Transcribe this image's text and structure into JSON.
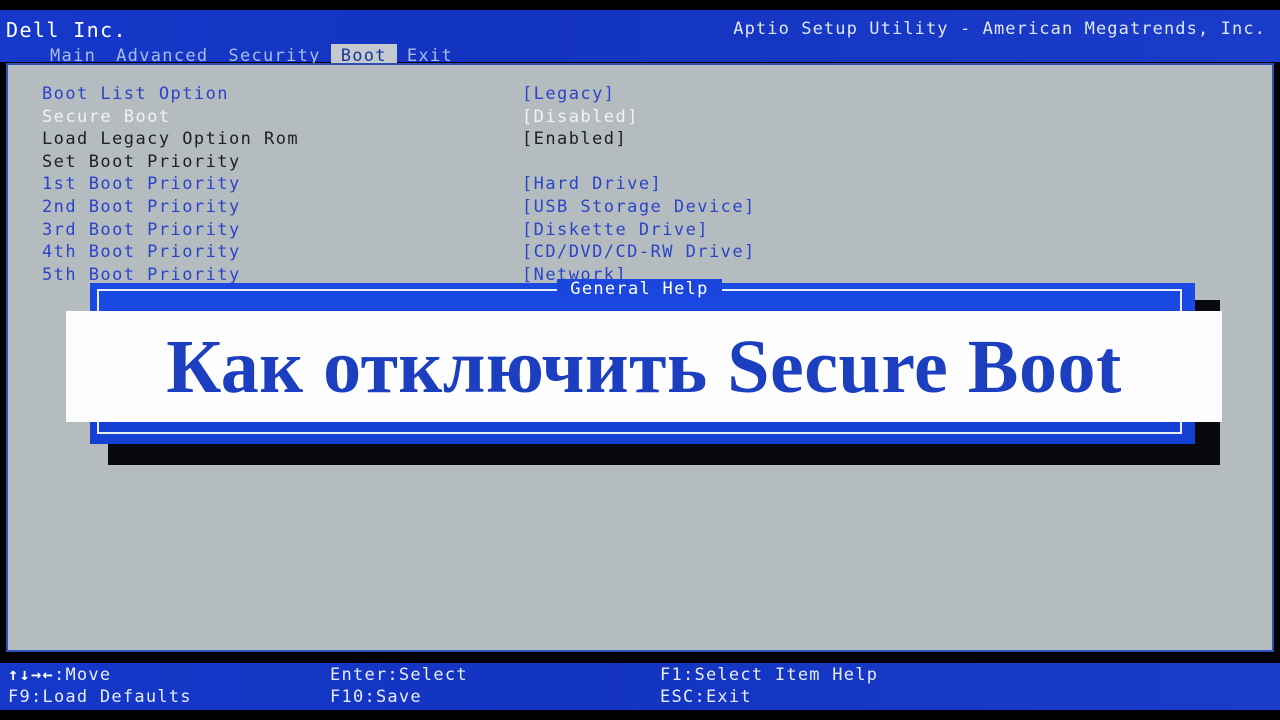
{
  "header": {
    "vendor": "Dell Inc.",
    "utility_title": "Aptio Setup Utility - American Megatrends, Inc.",
    "tabs": [
      {
        "label": "Main",
        "active": false
      },
      {
        "label": "Advanced",
        "active": false
      },
      {
        "label": "Security",
        "active": false
      },
      {
        "label": "Boot",
        "active": true
      },
      {
        "label": "Exit",
        "active": false
      }
    ]
  },
  "settings": [
    {
      "label": "Boot List Option",
      "value": "[Legacy]",
      "label_color": "blue",
      "value_color": "blue"
    },
    {
      "label": "Secure Boot",
      "value": "[Disabled]",
      "label_color": "white",
      "value_color": "white"
    },
    {
      "label": "Load Legacy Option Rom",
      "value": "[Enabled]",
      "label_color": "dark",
      "value_color": "dark"
    },
    {
      "label": "Set Boot Priority",
      "value": "",
      "label_color": "dark",
      "value_color": "dark"
    },
    {
      "label": "1st Boot Priority",
      "value": "[Hard Drive]",
      "label_color": "blue",
      "value_color": "blue"
    },
    {
      "label": "2nd Boot Priority",
      "value": "[USB Storage Device]",
      "label_color": "blue",
      "value_color": "blue"
    },
    {
      "label": "3rd Boot Priority",
      "value": "[Diskette Drive]",
      "label_color": "blue",
      "value_color": "blue"
    },
    {
      "label": "4th Boot Priority",
      "value": "[CD/DVD/CD-RW Drive]",
      "label_color": "blue",
      "value_color": "blue"
    },
    {
      "label": "5th Boot Priority",
      "value": "[Network]",
      "label_color": "blue",
      "value_color": "blue"
    }
  ],
  "dialog": {
    "title": "General Help"
  },
  "overlay": {
    "text": "Как отключить Secure Boot",
    "text_color": "#1b3fbe",
    "background_color": "#fdfdfd"
  },
  "statusbar": {
    "move_arrows": "↑↓→←",
    "move_label": ":Move",
    "enter_select": "Enter:Select",
    "select_item_help": "F1:Select Item Help",
    "load_defaults": "F9:Load Defaults",
    "save": "F10:Save",
    "exit": "ESC:Exit"
  },
  "colors": {
    "accent_blue": "#1136c4",
    "panel_gray": "#b5bcc0",
    "item_blue": "#2a44c8",
    "highlight_white": "#f2f2ee",
    "dialog_blue": "#1a46dd"
  }
}
